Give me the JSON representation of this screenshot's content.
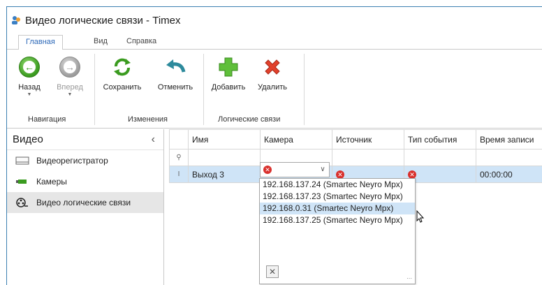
{
  "window": {
    "title": "Видео логические связи - Timex"
  },
  "tabs": [
    {
      "label": "Главная",
      "active": true
    },
    {
      "label": "Вид",
      "active": false
    },
    {
      "label": "Справка",
      "active": false
    }
  ],
  "ribbon": {
    "buttons": {
      "back": "Назад",
      "forward": "Вперед",
      "save": "Сохранить",
      "cancel": "Отменить",
      "add": "Добавить",
      "delete": "Удалить"
    },
    "groups": {
      "navigation": "Навигация",
      "changes": "Изменения",
      "links": "Логические связи"
    }
  },
  "sidebar": {
    "header": "Видео",
    "items": [
      {
        "label": "Видеорегистратор",
        "icon": "dvr-icon"
      },
      {
        "label": "Камеры",
        "icon": "camera-icon"
      },
      {
        "label": "Видео логические связи",
        "icon": "film-reel-icon",
        "active": true
      }
    ]
  },
  "grid": {
    "columns": [
      "Имя",
      "Камера",
      "Источник",
      "Тип события",
      "Время записи"
    ],
    "row": {
      "name": "Выход 3",
      "time": "00:00:00"
    }
  },
  "dropdown": {
    "options": [
      "192.168.137.24 (Smartec Neyro Mpx)",
      "192.168.137.23 (Smartec Neyro Mpx)",
      "192.168.0.31 (Smartec Neyro Mpx)",
      "192.168.137.25 (Smartec Neyro Mpx)"
    ],
    "hovered_index": 2
  },
  "colors": {
    "accent": "#2c68b8",
    "selection": "#cfe4f7",
    "error": "#d9302c",
    "green": "#3a9b1f"
  }
}
